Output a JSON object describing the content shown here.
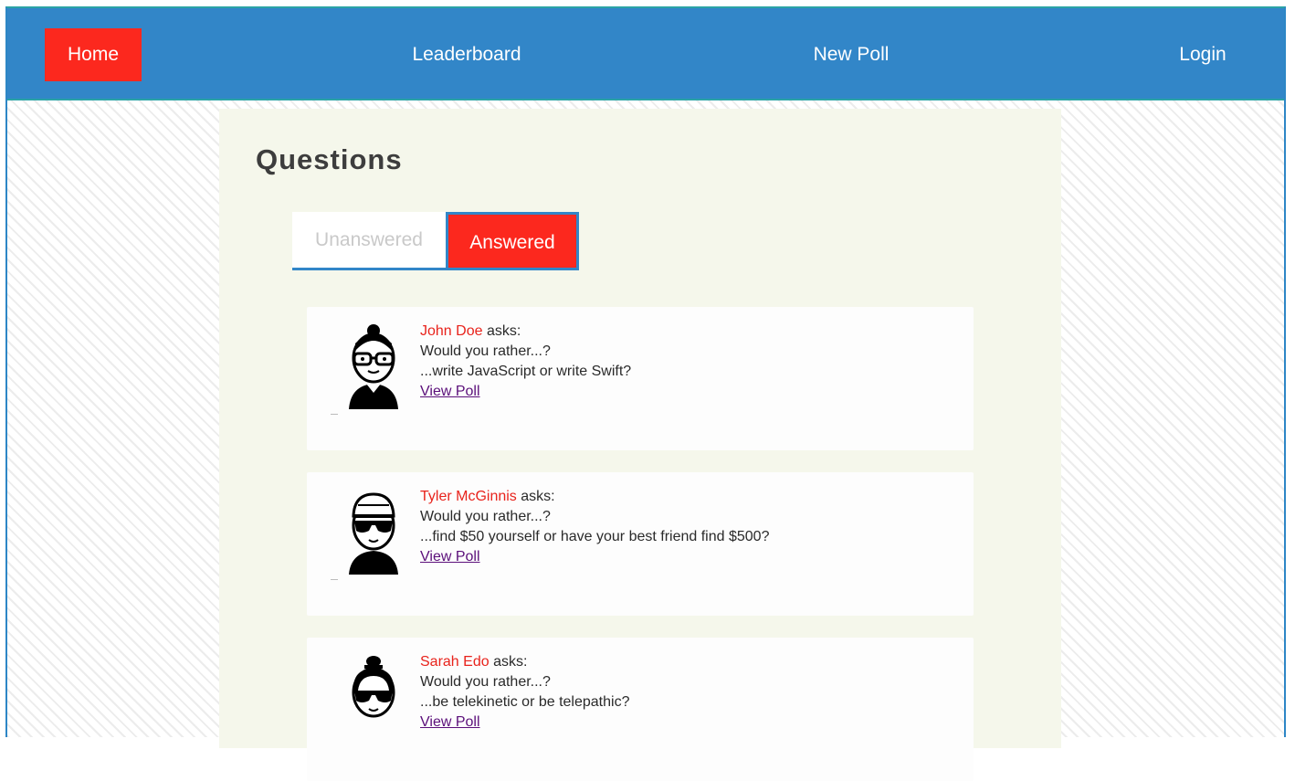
{
  "nav": {
    "home": "Home",
    "leaderboard": "Leaderboard",
    "new_poll": "New Poll",
    "login": "Login"
  },
  "main": {
    "title": "Questions",
    "tabs": [
      {
        "label": "Unanswered",
        "active": false
      },
      {
        "label": "Answered",
        "active": true
      }
    ],
    "asks_label": "asks:",
    "would_you_rather": "Would you rather...?",
    "view_poll": "View Poll",
    "questions": [
      {
        "author": "John Doe",
        "options_text": "...write JavaScript or write Swift?",
        "avatar": "man-with-glasses-avatar"
      },
      {
        "author": "Tyler McGinnis",
        "options_text": "...find $50 yourself or have your best friend find $500?",
        "avatar": "man-with-cap-and-sunglasses-avatar"
      },
      {
        "author": "Sarah Edo",
        "options_text": "...be telekinetic or be telepathic?",
        "avatar": "woman-with-bun-and-sunglasses-avatar"
      }
    ]
  },
  "colors": {
    "nav_bg": "#3286c8",
    "accent_red": "#fc281e",
    "panel_bg": "#f5f7eb",
    "link_visited": "#5b0f7a"
  }
}
